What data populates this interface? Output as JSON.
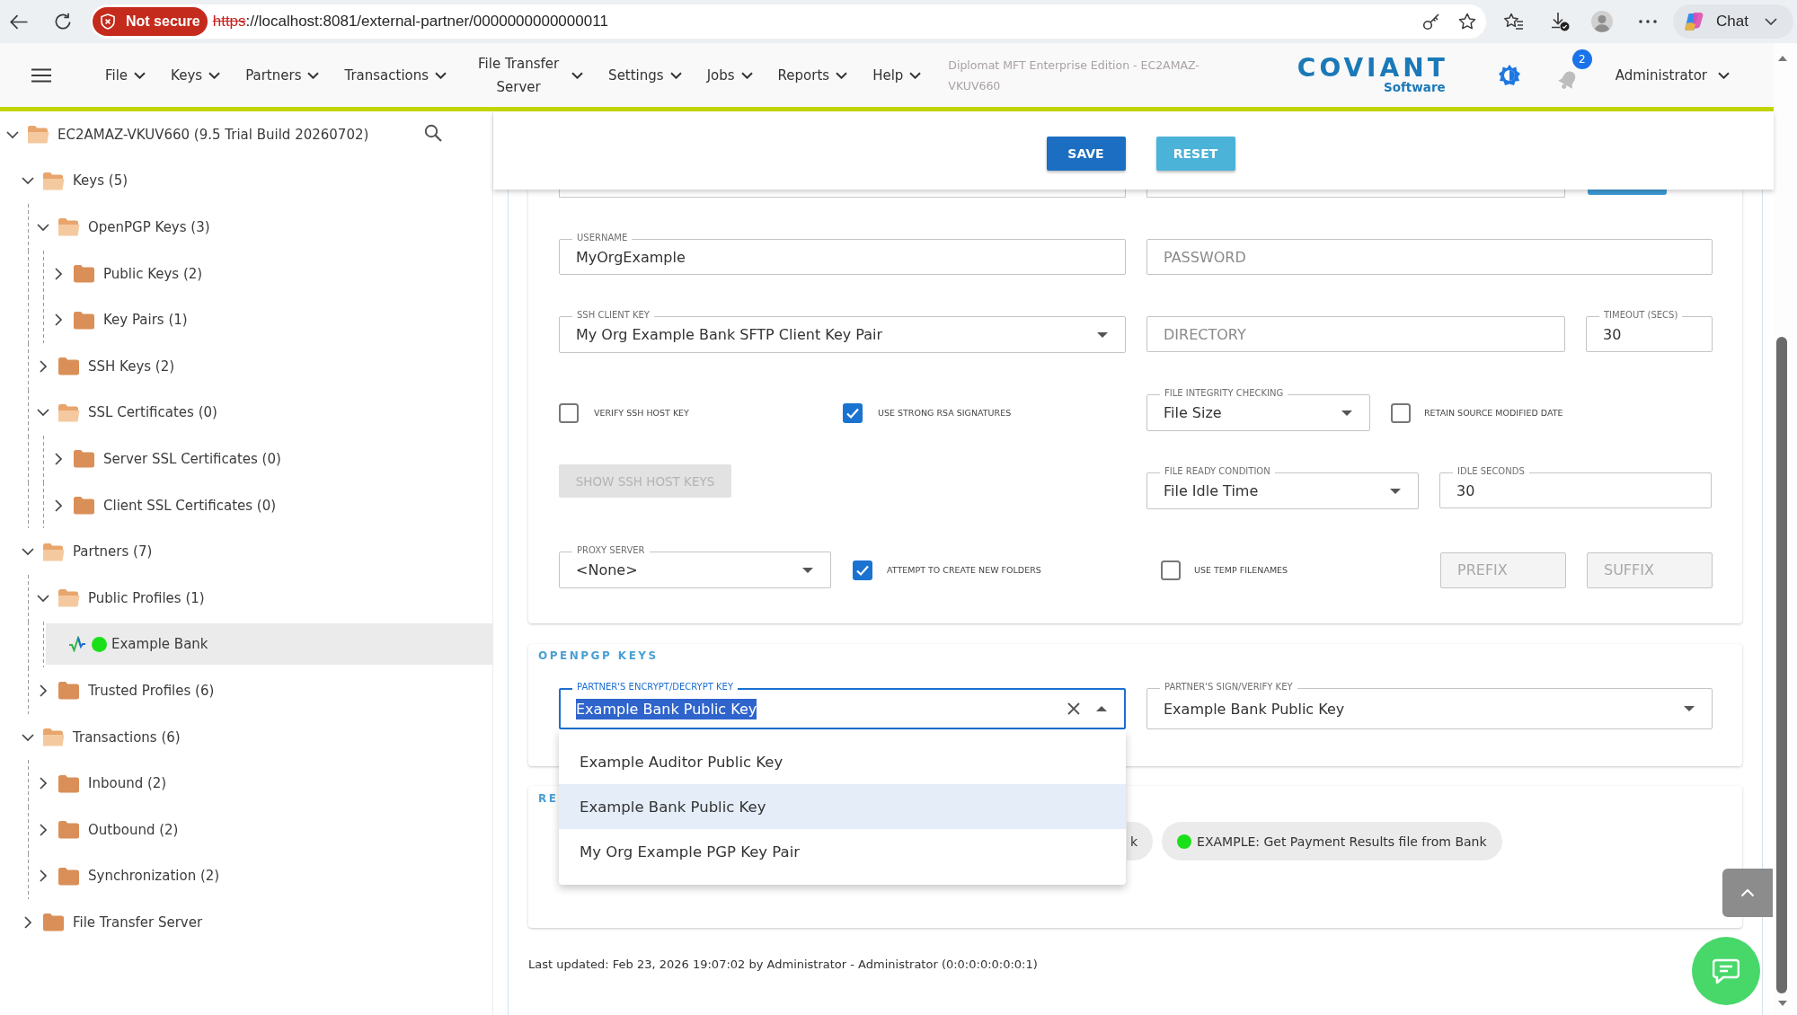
{
  "browser": {
    "security_badge": "Not secure",
    "url": {
      "scheme": "https",
      "rest": "://localhost:8081/external-partner/0000000000000011"
    },
    "chat_button": "Chat"
  },
  "header": {
    "menus": [
      {
        "label": "File"
      },
      {
        "label": "Keys"
      },
      {
        "label": "Partners"
      },
      {
        "label": "Transactions"
      },
      {
        "label": "File Transfer Server"
      },
      {
        "label": "Settings"
      },
      {
        "label": "Jobs"
      },
      {
        "label": "Reports"
      },
      {
        "label": "Help"
      }
    ],
    "edition": "Diplomat MFT Enterprise Edition - EC2AMAZ-VKUV660",
    "logo": {
      "wordmark": "COVIANT",
      "tagline": "Software"
    },
    "notification_count": "2",
    "user": "Administrator"
  },
  "tree": {
    "items": [
      {
        "label": "EC2AMAZ-VKUV660 (9.5 Trial Build 20260702)",
        "kind": "folder",
        "expanded": true,
        "selected": false,
        "children": [
          {
            "label": "Keys (5)",
            "kind": "folder",
            "expanded": true,
            "selected": false,
            "children": [
              {
                "label": "OpenPGP Keys (3)",
                "kind": "folder",
                "expanded": true,
                "selected": false,
                "children": [
                  {
                    "label": "Public Keys (2)",
                    "kind": "folder",
                    "expanded": false,
                    "selected": false
                  },
                  {
                    "label": "Key Pairs (1)",
                    "kind": "folder",
                    "expanded": false,
                    "selected": false
                  }
                ]
              },
              {
                "label": "SSH Keys (2)",
                "kind": "folder",
                "expanded": false,
                "selected": false
              },
              {
                "label": "SSL Certificates (0)",
                "kind": "folder",
                "expanded": true,
                "selected": false,
                "children": [
                  {
                    "label": "Server SSL Certificates (0)",
                    "kind": "folder",
                    "expanded": false,
                    "selected": false
                  },
                  {
                    "label": "Client SSL Certificates (0)",
                    "kind": "folder",
                    "expanded": false,
                    "selected": false
                  }
                ]
              }
            ]
          },
          {
            "label": "Partners (7)",
            "kind": "folder",
            "expanded": true,
            "selected": false,
            "children": [
              {
                "label": "Public Profiles (1)",
                "kind": "folder",
                "expanded": true,
                "selected": false,
                "children": [
                  {
                    "label": "Example Bank",
                    "kind": "partner",
                    "selected": true,
                    "color": "#19e019"
                  }
                ]
              },
              {
                "label": "Trusted Profiles (6)",
                "kind": "folder",
                "expanded": false,
                "selected": false
              }
            ]
          },
          {
            "label": "Transactions (6)",
            "kind": "folder",
            "expanded": true,
            "selected": false,
            "children": [
              {
                "label": "Inbound (2)",
                "kind": "folder",
                "expanded": false,
                "selected": false
              },
              {
                "label": "Outbound (2)",
                "kind": "folder",
                "expanded": false,
                "selected": false
              },
              {
                "label": "Synchronization (2)",
                "kind": "folder",
                "expanded": false,
                "selected": false
              }
            ]
          },
          {
            "label": "File Transfer Server",
            "kind": "folder",
            "expanded": false,
            "selected": false
          }
        ]
      }
    ]
  },
  "toolbar": {
    "buttons": [
      {
        "label": "SAVE",
        "kind": "primary"
      },
      {
        "label": "RESET",
        "kind": "secondary"
      }
    ]
  },
  "connection": {
    "hidden_row": [
      {
        "kind": "field"
      },
      {
        "kind": "field"
      },
      {
        "kind": "button"
      }
    ],
    "username": {
      "label": "USERNAME",
      "value": "MyOrgExample"
    },
    "password": {
      "placeholder": "PASSWORD"
    },
    "ssh_client_key": {
      "label": "SSH CLIENT KEY",
      "value": "My Org Example Bank SFTP Client Key Pair"
    },
    "directory": {
      "placeholder": "DIRECTORY"
    },
    "timeout": {
      "label": "TIMEOUT (SECS)",
      "value": "30"
    },
    "verify_ssh_host_key": {
      "label": "VERIFY SSH HOST KEY",
      "checked": false
    },
    "use_strong_rsa_signatures": {
      "label": "USE STRONG RSA SIGNATURES",
      "checked": true
    },
    "file_integrity_checking": {
      "label": "FILE INTEGRITY CHECKING",
      "value": "File Size"
    },
    "retain_source_modified_date": {
      "label": "RETAIN SOURCE MODIFIED DATE",
      "checked": false
    },
    "show_ssh_host_keys": {
      "label": "SHOW SSH HOST KEYS",
      "disabled": true
    },
    "file_ready_condition": {
      "label": "FILE READY CONDITION",
      "value": "File Idle Time"
    },
    "idle_seconds": {
      "label": "IDLE SECONDS",
      "value": "30"
    },
    "proxy_server": {
      "label": "PROXY SERVER",
      "value": "<None>"
    },
    "attempt_to_create_new_folders": {
      "label": "ATTEMPT TO CREATE NEW FOLDERS",
      "checked": true
    },
    "use_temp_filenames": {
      "label": "USE TEMP FILENAMES",
      "checked": false
    },
    "prefix": {
      "placeholder": "PREFIX",
      "disabled": true
    },
    "suffix": {
      "placeholder": "SUFFIX",
      "disabled": true
    }
  },
  "openpgp_keys": {
    "title": "OPENPGP KEYS",
    "encrypt_decrypt_key": {
      "label": "PARTNER'S ENCRYPT/DECRYPT KEY",
      "value": "Example Bank Public Key",
      "expanded": true,
      "text_highlighted": true,
      "options": [
        {
          "label": "Example Auditor Public Key",
          "selected": false
        },
        {
          "label": "Example Bank Public Key",
          "selected": true
        },
        {
          "label": "My Org Example PGP Key Pair",
          "selected": false
        }
      ]
    },
    "sign_verify_key": {
      "label": "PARTNER'S SIGN/VERIFY KEY",
      "value": "Example Bank Public Key",
      "expanded": false
    }
  },
  "section_3": {
    "title": "RE",
    "chips": [
      {
        "label": "k"
      },
      {
        "label": "EXAMPLE: Get Payment Results file from Bank",
        "color": "#19e019"
      }
    ]
  },
  "footer": {
    "last_updated": "Last updated: Feb 23, 2026 19:07:02 by Administrator - Administrator (0:0:0:0:0:0:0:1)"
  }
}
